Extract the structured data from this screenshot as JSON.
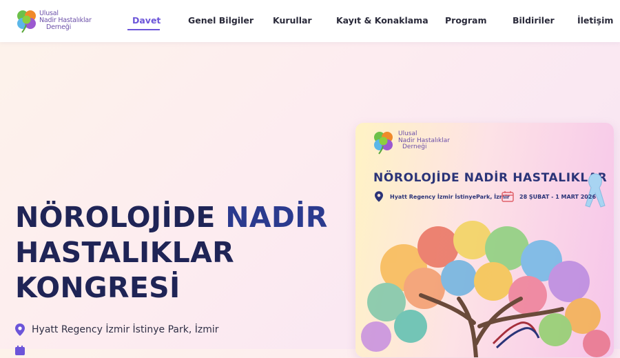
{
  "brand": {
    "lines": [
      "Ulusal",
      "Nadir Hastalıklar",
      "Derneği"
    ]
  },
  "nav": {
    "items": [
      {
        "label": "Davet",
        "active": true
      },
      {
        "label": "Genel Bilgiler"
      },
      {
        "label": "Kurullar"
      },
      {
        "label": "Kayıt & Konaklama"
      },
      {
        "label": "Program"
      },
      {
        "label": "Bildiriler"
      },
      {
        "label": "İletişim"
      }
    ]
  },
  "hero": {
    "title_line1_a": "NÖROLOJİDE",
    "title_line1_b": "NADİR",
    "title_line2": "HASTALIKLAR",
    "title_line3": "KONGRESİ",
    "location": "Hyatt Regency İzmir İstinye Park, İzmir"
  },
  "poster": {
    "logo_lines": [
      "Ulusal",
      "Nadir Hastalıklar",
      "Derneği"
    ],
    "title": "NÖROLOJİDE NADİR HASTALIKLAR",
    "venue": "Hyatt Regency İzmir İstinyePark, İzmir",
    "date": "28 ŞUBAT - 1 MART 2026"
  },
  "colors": {
    "accent": "#6c55d9",
    "title": "#1f2456",
    "brand": "#6b4fa8"
  },
  "icons": {
    "location": "map-pin-icon",
    "calendar": "calendar-icon",
    "logo": "clover-logo-icon"
  }
}
